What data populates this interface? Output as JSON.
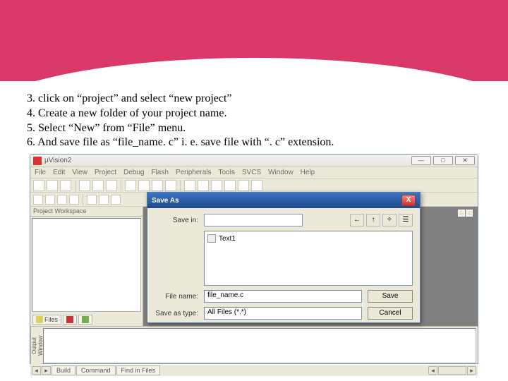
{
  "instructions": {
    "line1": "3. click on “project” and select “new project”",
    "line2": "4. Create a new folder of your project name.",
    "line3": "5. Select “New” from “File” menu.",
    "line4": "6. And save file as “file_name. c” i. e. save file with “. c” extension."
  },
  "app": {
    "title": "µVision2",
    "menu": {
      "file": "File",
      "edit": "Edit",
      "view": "View",
      "project": "Project",
      "debug": "Debug",
      "flash": "Flash",
      "peripherals": "Peripherals",
      "tools": "Tools",
      "svcs": "SVCS",
      "window": "Window",
      "help": "Help"
    },
    "workspace": {
      "header": "Project Workspace",
      "tabs": {
        "files": "Files",
        "regs": "",
        "books": ""
      }
    },
    "vert_label": "Output Window",
    "status_tabs": {
      "build": "Build",
      "command": "Command",
      "find": "Find in Files"
    },
    "win_controls": {
      "min": "—",
      "max": "□",
      "close": "✕"
    }
  },
  "dialog": {
    "title": "Save As",
    "savein_label": "Save in:",
    "savein_value": "",
    "file_item": "Text1",
    "filename_label": "File name:",
    "filename_value": "file_name.c",
    "saveas_label": "Save as type:",
    "saveas_value": "All Files (*.*)",
    "save_btn": "Save",
    "cancel_btn": "Cancel",
    "close": "X"
  }
}
